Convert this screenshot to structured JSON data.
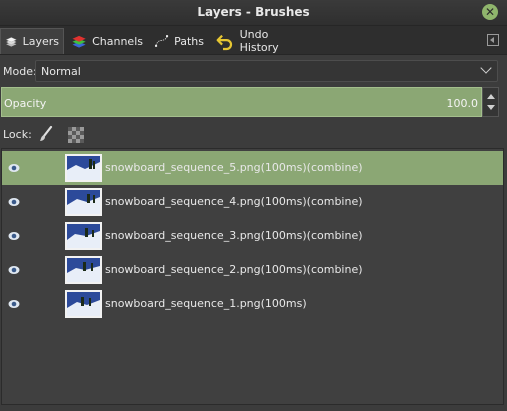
{
  "window": {
    "title": "Layers - Brushes"
  },
  "tabs": [
    {
      "label": "Layers",
      "icon": "layers-icon"
    },
    {
      "label": "Channels",
      "icon": "channels-icon"
    },
    {
      "label": "Paths",
      "icon": "paths-icon"
    },
    {
      "label": "Undo History",
      "icon": "undo-icon"
    }
  ],
  "mode": {
    "label": "Mode:",
    "value": "Normal"
  },
  "opacity": {
    "label": "Opacity",
    "value": "100.0"
  },
  "lock": {
    "label": "Lock:"
  },
  "layers": [
    {
      "name": "snowboard_sequence_5.png(100ms)(combine)",
      "selected": true,
      "visible": true
    },
    {
      "name": "snowboard_sequence_4.png(100ms)(combine)",
      "selected": false,
      "visible": true
    },
    {
      "name": "snowboard_sequence_3.png(100ms)(combine)",
      "selected": false,
      "visible": true
    },
    {
      "name": "snowboard_sequence_2.png(100ms)(combine)",
      "selected": false,
      "visible": true
    },
    {
      "name": "snowboard_sequence_1.png(100ms)",
      "selected": false,
      "visible": true
    }
  ],
  "colors": {
    "accent": "#8ba774",
    "background": "#3c3c3c",
    "close": "#8fb56c"
  }
}
